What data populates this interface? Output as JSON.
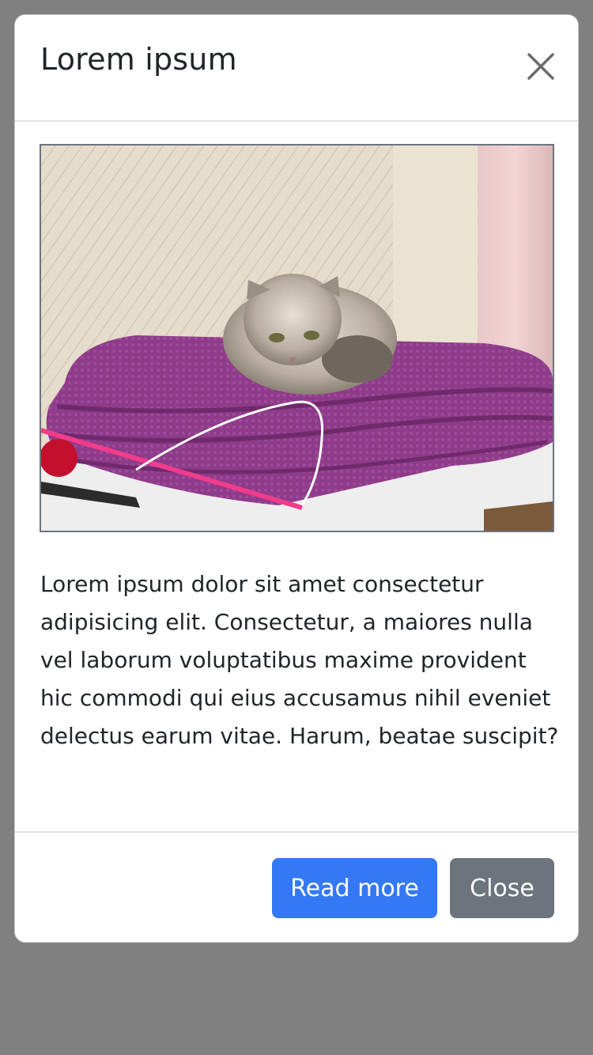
{
  "modal": {
    "title": "Lorem ipsum",
    "body_text": "Lorem ipsum dolor sit amet consectetur adipisicing elit. Consectetur, a maiores nulla vel laborum voluptatibus maxime provident hic commodi qui eius accusamus nihil eveniet delectus earum vitae. Harum, beatae suscipit?",
    "image": {
      "subject": "cat-on-purple-towels"
    },
    "buttons": {
      "primary_label": "Read more",
      "secondary_label": "Close"
    },
    "close_icon": "close-icon"
  },
  "colors": {
    "backdrop": "#808080",
    "primary": "#3478f6",
    "secondary": "#6c757d"
  }
}
